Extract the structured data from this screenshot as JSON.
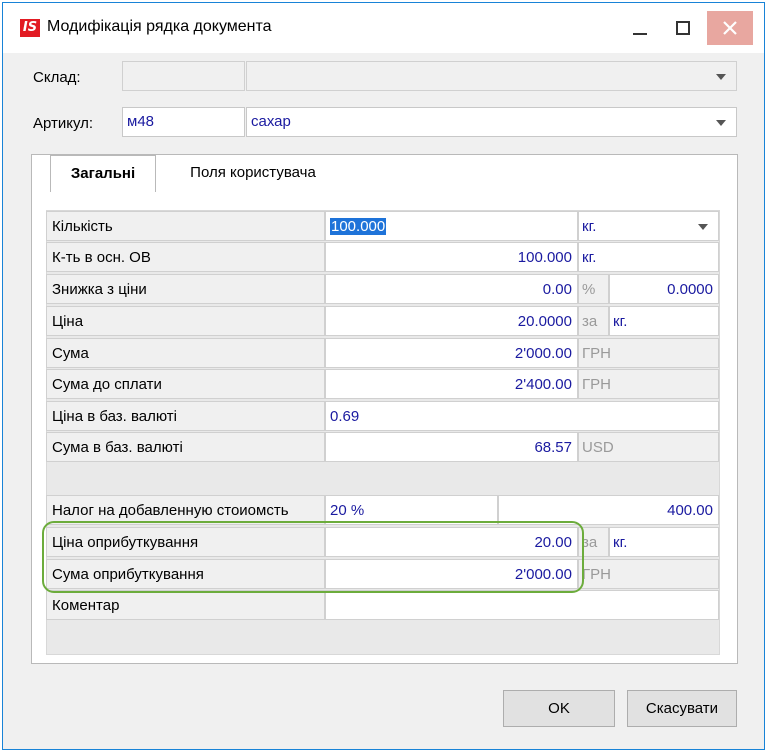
{
  "window": {
    "title": "Модифікація рядка документа",
    "icon_text": "IS"
  },
  "header": {
    "sklad_label": "Склад:",
    "sklad_code": "",
    "sklad_name": "",
    "artikul_label": "Артикул:",
    "artikul_code": "м48",
    "artikul_name": "сахар"
  },
  "tabs": [
    {
      "label": "Загальні",
      "active": true
    },
    {
      "label": "Поля користувача",
      "active": false
    }
  ],
  "grid": {
    "rows": [
      {
        "label": "Кількість",
        "value": "100.000",
        "unit": "кг."
      },
      {
        "label": "К-ть в осн. ОВ",
        "value": "100.000",
        "unit": "кг."
      },
      {
        "label": "Знижка з ціни",
        "value": "0.00",
        "unit": "%",
        "extra": "0.0000"
      },
      {
        "label": "Ціна",
        "value": "20.0000",
        "unit": "за",
        "extra": "кг."
      },
      {
        "label": "Сума",
        "value": "2'000.00",
        "unit": "ГРН"
      },
      {
        "label": "Сума до сплати",
        "value": "2'400.00",
        "unit": "ГРН"
      },
      {
        "label": "Ціна в баз. валюті",
        "value": "0.69"
      },
      {
        "label": "Сума в баз. валюті",
        "value": "68.57",
        "unit": "USD"
      },
      {
        "label": "Налог на добавленную стоиомсть",
        "value": "20 %",
        "extra": "400.00"
      },
      {
        "label": "Ціна оприбуткування",
        "value": "20.00",
        "unit": "за",
        "extra": "кг."
      },
      {
        "label": "Сума оприбуткування",
        "value": "2'000.00",
        "unit": "ГРН"
      },
      {
        "label": "Коментар",
        "value": ""
      }
    ]
  },
  "buttons": {
    "ok": "OK",
    "cancel": "Скасувати"
  },
  "colors": {
    "title_icon": "#e21b23",
    "close_button": "#e8a7a0",
    "highlight": "#6cac3c",
    "value_text": "#1a1aa0",
    "selection": "#1e73d9"
  }
}
